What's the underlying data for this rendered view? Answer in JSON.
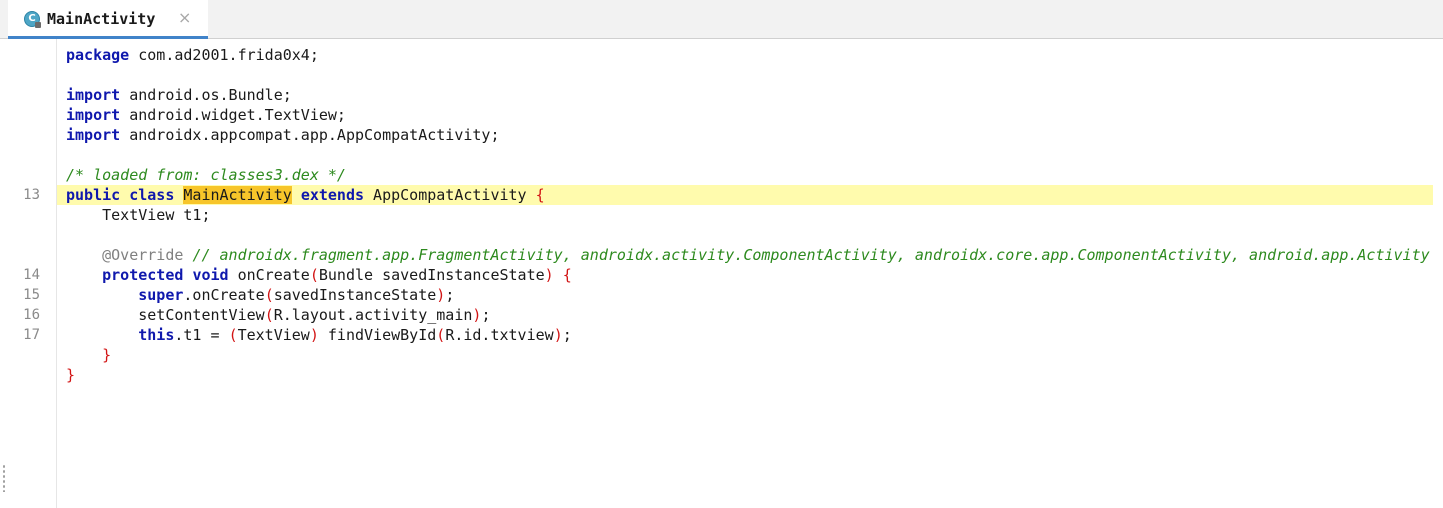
{
  "tab": {
    "title": "MainActivity",
    "icon_letter": "C",
    "close_glyph": "×",
    "icon": "class-icon",
    "close_icon": "close-icon"
  },
  "colors": {
    "keyword": "#0f18ad",
    "comment": "#2d8a1e",
    "brace": "#d21414",
    "current_line_bg": "#fffbad",
    "search_highlight": "#f7c52a",
    "tab_accent": "#4083c9"
  },
  "gutter": {
    "line_numbers": [
      {
        "row": 7,
        "num": "13"
      },
      {
        "row": 11,
        "num": "14"
      },
      {
        "row": 12,
        "num": "15"
      },
      {
        "row": 13,
        "num": "16"
      },
      {
        "row": 14,
        "num": "17"
      }
    ]
  },
  "code": {
    "lines": [
      [
        [
          "kw",
          "package"
        ],
        [
          "txt",
          " com.ad2001.frida0x4;"
        ]
      ],
      [],
      [
        [
          "kw",
          "import"
        ],
        [
          "txt",
          " android.os.Bundle;"
        ]
      ],
      [
        [
          "kw",
          "import"
        ],
        [
          "txt",
          " android.widget.TextView;"
        ]
      ],
      [
        [
          "kw",
          "import"
        ],
        [
          "txt",
          " androidx.appcompat.app.AppCompatActivity;"
        ]
      ],
      [],
      [
        [
          "cm",
          "/* loaded from: classes3.dex */"
        ]
      ],
      [
        [
          "kw",
          "public"
        ],
        [
          "txt",
          " "
        ],
        [
          "kw",
          "class"
        ],
        [
          "txt",
          " "
        ],
        [
          "hl",
          "MainActivity"
        ],
        [
          "txt",
          " "
        ],
        [
          "kw",
          "extends"
        ],
        [
          "txt",
          " AppCompatActivity "
        ],
        [
          "br",
          "{"
        ]
      ],
      [
        [
          "txt",
          "    TextView t1;"
        ]
      ],
      [],
      [
        [
          "txt",
          "    "
        ],
        [
          "an",
          "@Override"
        ],
        [
          "txt",
          " "
        ],
        [
          "cm",
          "// androidx.fragment.app.FragmentActivity, androidx.activity.ComponentActivity, androidx.core.app.ComponentActivity, android.app.Activity"
        ]
      ],
      [
        [
          "txt",
          "    "
        ],
        [
          "kw",
          "protected"
        ],
        [
          "txt",
          " "
        ],
        [
          "kw",
          "void"
        ],
        [
          "txt",
          " onCreate"
        ],
        [
          "br",
          "("
        ],
        [
          "txt",
          "Bundle savedInstanceState"
        ],
        [
          "br",
          ")"
        ],
        [
          "txt",
          " "
        ],
        [
          "br",
          "{"
        ]
      ],
      [
        [
          "txt",
          "        "
        ],
        [
          "kw",
          "super"
        ],
        [
          "txt",
          ".onCreate"
        ],
        [
          "br",
          "("
        ],
        [
          "txt",
          "savedInstanceState"
        ],
        [
          "br",
          ")"
        ],
        [
          "txt",
          ";"
        ]
      ],
      [
        [
          "txt",
          "        setContentView"
        ],
        [
          "br",
          "("
        ],
        [
          "txt",
          "R.layout.activity_main"
        ],
        [
          "br",
          ")"
        ],
        [
          "txt",
          ";"
        ]
      ],
      [
        [
          "txt",
          "        "
        ],
        [
          "kw",
          "this"
        ],
        [
          "txt",
          ".t1 = "
        ],
        [
          "br",
          "("
        ],
        [
          "txt",
          "TextView"
        ],
        [
          "br",
          ")"
        ],
        [
          "txt",
          " findViewById"
        ],
        [
          "br",
          "("
        ],
        [
          "txt",
          "R.id.txtview"
        ],
        [
          "br",
          ")"
        ],
        [
          "txt",
          ";"
        ]
      ],
      [
        [
          "txt",
          "    "
        ],
        [
          "br",
          "}"
        ]
      ],
      [
        [
          "br",
          "}"
        ]
      ]
    ],
    "current_line_row": 7
  }
}
